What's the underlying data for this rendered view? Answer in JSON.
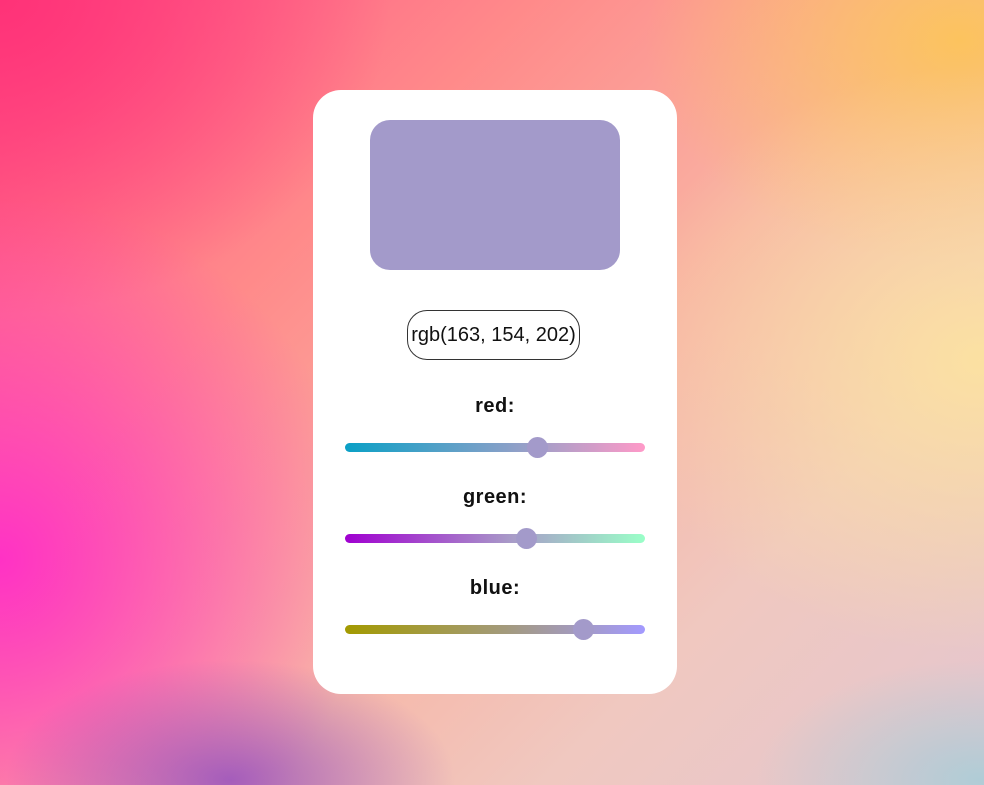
{
  "color": {
    "r": 163,
    "g": 154,
    "b": 202,
    "hex": "#a39aca"
  },
  "readout": {
    "text": "rgb(163, 154, 202)"
  },
  "sliders": [
    {
      "key": "red",
      "label": "red:",
      "value": 163,
      "max": 255
    },
    {
      "key": "green",
      "label": "green:",
      "value": 154,
      "max": 255
    },
    {
      "key": "blue",
      "label": "blue:",
      "value": 202,
      "max": 255
    }
  ]
}
